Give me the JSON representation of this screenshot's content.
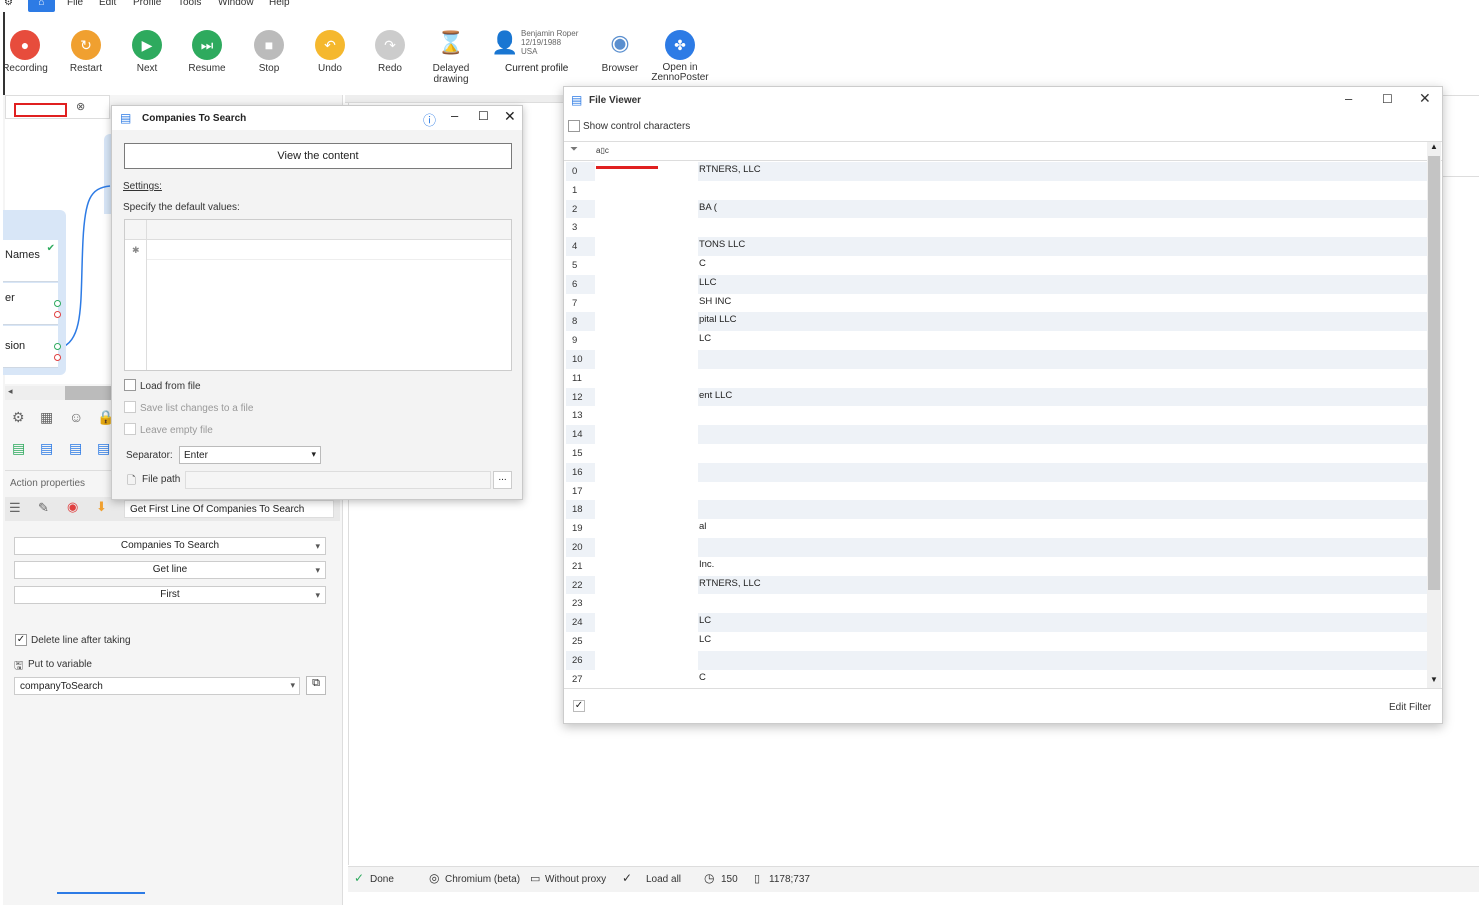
{
  "menu": {
    "items": [
      "File",
      "Edit",
      "Profile",
      "Tools",
      "Window",
      "Help"
    ]
  },
  "toolbar": {
    "buttons": [
      {
        "label": "Recording",
        "color": "#e74c3c",
        "glyph": "●"
      },
      {
        "label": "Restart",
        "color": "#f0a030",
        "glyph": "↻"
      },
      {
        "label": "Next",
        "color": "#2eaa5e",
        "glyph": "▶"
      },
      {
        "label": "Resume",
        "color": "#2eaa5e",
        "glyph": "⏭"
      },
      {
        "label": "Stop",
        "color": "#bbbbbb",
        "glyph": "■"
      },
      {
        "label": "Undo",
        "color": "#f5b82e",
        "glyph": "↶"
      },
      {
        "label": "Redo",
        "color": "#cccccc",
        "glyph": "↷"
      }
    ],
    "delayed_label": "Delayed drawing",
    "profile": {
      "name": "Benjamin Roper",
      "dob": "12/19/1988",
      "country": "USA",
      "label": "Current profile"
    },
    "browser_label": "Browser",
    "zenno_label": "Open in ZennoPoster"
  },
  "node": {
    "rows": [
      "Names",
      "er",
      "sion"
    ]
  },
  "left": {
    "section_title": "Action properties",
    "action_name": "Get First Line Of Companies To Search",
    "dropdown_list": "Companies To Search",
    "dropdown_op": "Get line",
    "dropdown_pos": "First",
    "delete_line_label": "Delete line after taking",
    "put_to_variable_label": "Put to variable",
    "variable_value": "companyToSearch"
  },
  "companies": {
    "title": "Companies To Search",
    "view_button": "View the content",
    "settings_label": "Settings:",
    "default_values_label": "Specify the default values:",
    "load_from_file": "Load from file",
    "save_changes": "Save list changes to a file",
    "leave_empty": "Leave empty file",
    "separator_label": "Separator:",
    "separator_value": "Enter",
    "file_path_label": "File path",
    "browse": "..."
  },
  "fileviewer": {
    "title": "File Viewer",
    "show_control": "Show control characters",
    "filter_glyph": "a▯c",
    "edit_filter": "Edit Filter",
    "rows": [
      {
        "n": "0",
        "t": "RTNERS, LLC"
      },
      {
        "n": "1",
        "t": ""
      },
      {
        "n": "2",
        "t": "BA ("
      },
      {
        "n": "3",
        "t": ""
      },
      {
        "n": "4",
        "t": "TONS LLC"
      },
      {
        "n": "5",
        "t": "C"
      },
      {
        "n": "6",
        "t": "LLC"
      },
      {
        "n": "7",
        "t": "SH INC"
      },
      {
        "n": "8",
        "t": "pital LLC"
      },
      {
        "n": "9",
        "t": "LC"
      },
      {
        "n": "10",
        "t": ""
      },
      {
        "n": "11",
        "t": ""
      },
      {
        "n": "12",
        "t": "ent LLC"
      },
      {
        "n": "13",
        "t": ""
      },
      {
        "n": "14",
        "t": ""
      },
      {
        "n": "15",
        "t": ""
      },
      {
        "n": "16",
        "t": ""
      },
      {
        "n": "17",
        "t": ""
      },
      {
        "n": "18",
        "t": ""
      },
      {
        "n": "19",
        "t": "al"
      },
      {
        "n": "20",
        "t": ""
      },
      {
        "n": "21",
        "t": "Inc."
      },
      {
        "n": "22",
        "t": "RTNERS, LLC"
      },
      {
        "n": "23",
        "t": ""
      },
      {
        "n": "24",
        "t": "LC"
      },
      {
        "n": "25",
        "t": "LC"
      },
      {
        "n": "26",
        "t": ""
      },
      {
        "n": "27",
        "t": "C"
      }
    ]
  },
  "status": {
    "done": "Done",
    "browser": "Chromium (beta)",
    "proxy": "Without proxy",
    "load": "Load all",
    "timer": "150",
    "coords": "1178;737"
  }
}
